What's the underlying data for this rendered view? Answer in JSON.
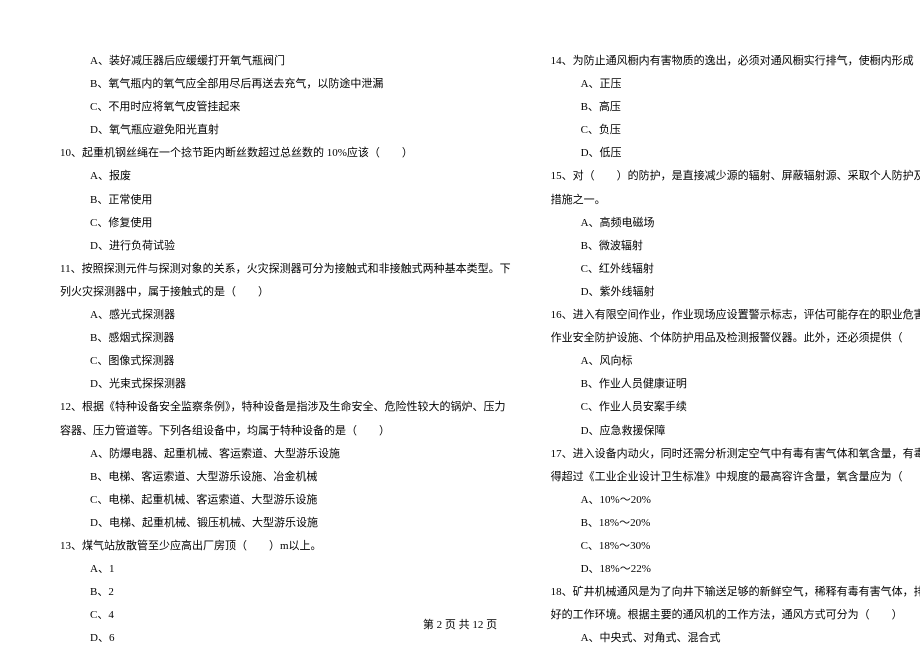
{
  "leftColumn": {
    "q9_opts": {
      "A": "A、装好减压器后应缓缓打开氧气瓶阀门",
      "B": "B、氧气瓶内的氧气应全部用尽后再送去充气，以防途中泄漏",
      "C": "C、不用时应将氧气皮管挂起来",
      "D": "D、氧气瓶应避免阳光直射"
    },
    "q10": "10、起重机钢丝绳在一个捻节距内断丝数超过总丝数的 10%应该（　　）",
    "q10_opts": {
      "A": "A、报废",
      "B": "B、正常使用",
      "C": "C、修复使用",
      "D": "D、进行负荷试验"
    },
    "q11_line1": "11、按照探测元件与探测对象的关系，火灾探测器可分为接触式和非接触式两种基本类型。下",
    "q11_line2": "列火灾探测器中，属于接触式的是（　　）",
    "q11_opts": {
      "A": "A、感光式探测器",
      "B": "B、感烟式探测器",
      "C": "C、图像式探测器",
      "D": "D、光束式探探测器"
    },
    "q12_line1": "12、根据《特种设备安全监察条例》，特种设备是指涉及生命安全、危险性较大的锅炉、压力",
    "q12_line2": "容器、压力管道等。下列各组设备中，均属于特种设备的是（　　）",
    "q12_opts": {
      "A": "A、防爆电器、起重机械、客运索道、大型游乐设施",
      "B": "B、电梯、客运索道、大型游乐设施、冶金机械",
      "C": "C、电梯、起重机械、客运索道、大型游乐设施",
      "D": "D、电梯、起重机械、锻压机械、大型游乐设施"
    },
    "q13": "13、煤气站放散管至少应高出厂房顶（　　）m以上。",
    "q13_opts": {
      "A": "A、1",
      "B": "B、2",
      "C": "C、4",
      "D": "D、6"
    }
  },
  "rightColumn": {
    "q14": "14、为防止通风橱内有害物质的逸出，必须对通风橱实行排气，使橱内形成（　　）状态。",
    "q14_opts": {
      "A": "A、正压",
      "B": "B、高压",
      "C": "C、负压",
      "D": "D、低压"
    },
    "q15_line1": "15、对（　　）的防护，是直接减少源的辐射、屏蔽辐射源、采取个人防护及执行安全规则的",
    "q15_line2": "措施之一。",
    "q15_opts": {
      "A": "A、高频电磁场",
      "B": "B、微波辐射",
      "C": "C、红外线辐射",
      "D": "D、紫外线辐射"
    },
    "q16_line1": "16、进入有限空间作业，作业现场应设置警示标志，评估可能存在的职业危害，并提供合格的",
    "q16_line2": "作业安全防护设施、个体防护用品及检测报警仪器。此外，还必须提供（　　）",
    "q16_opts": {
      "A": "A、风向标",
      "B": "B、作业人员健康证明",
      "C": "C、作业人员安案手续",
      "D": "D、应急救援保障"
    },
    "q17_line1": "17、进入设备内动火，同时还需分析测定空气中有毒有害气体和氧含量，有毒有害气体含量不",
    "q17_line2": "得超过《工业企业设计卫生标准》中规度的最高容许含量，氧含量应为（　　）",
    "q17_opts": {
      "A": "A、10%～20%",
      "B": "B、18%～20%",
      "C": "C、18%～30%",
      "D": "D、18%～22%"
    },
    "q18_line1": "18、矿井机械通风是为了向井下输送足够的新鲜空气，稀释有毒有害气体，排除矿尘，保持良",
    "q18_line2": "好的工作环境。根据主要的通风机的工作方法，通风方式可分为（　　）",
    "q18_opts": {
      "A": "A、中央式、对角式、混合式"
    }
  },
  "footer": "第 2 页 共 12 页"
}
